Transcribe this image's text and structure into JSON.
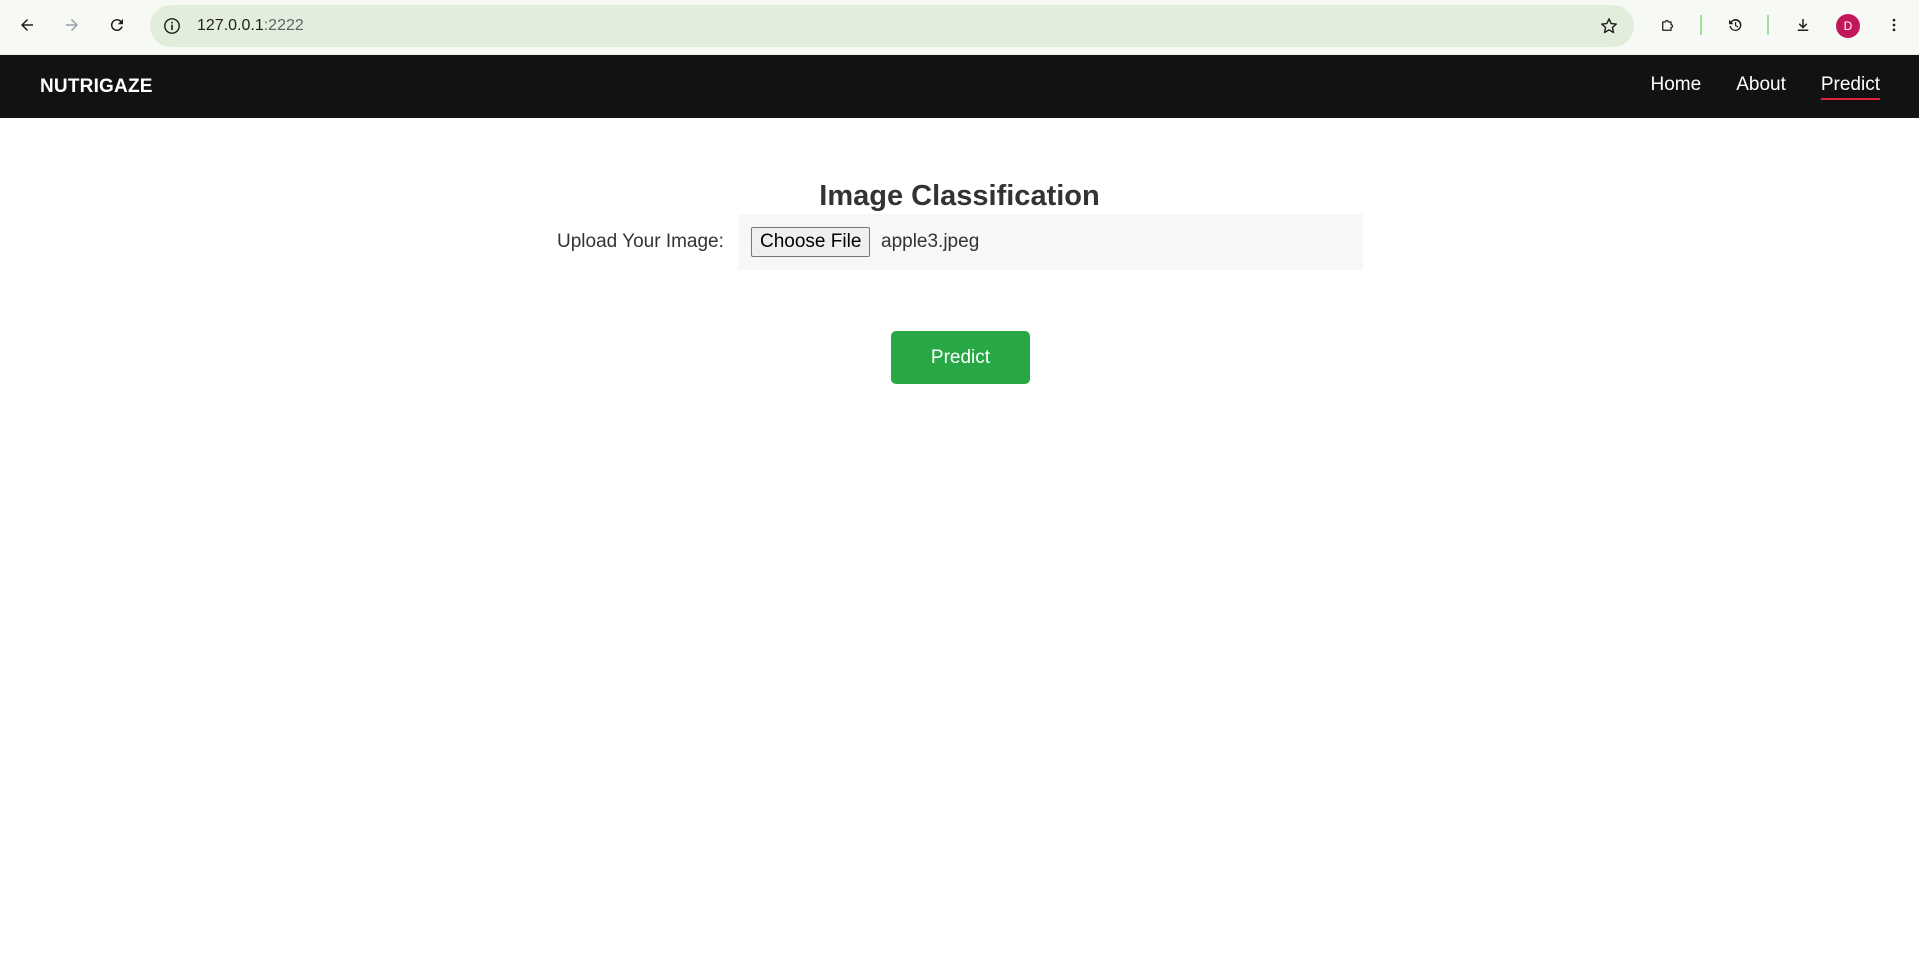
{
  "browser": {
    "url_host": "127.0.0.1",
    "url_port": ":2222",
    "profile_initial": "D"
  },
  "nav": {
    "brand": "NUTRIGAZE",
    "links": [
      {
        "label": "Home"
      },
      {
        "label": "About"
      },
      {
        "label": "Predict",
        "active": true
      }
    ],
    "active_underline_color": "#e0213a"
  },
  "main": {
    "title": "Image Classification",
    "upload_label": "Upload Your Image:",
    "choose_file_label": "Choose File",
    "selected_file": "apple3.jpeg",
    "predict_label": "Predict",
    "predict_color": "#28a745"
  }
}
